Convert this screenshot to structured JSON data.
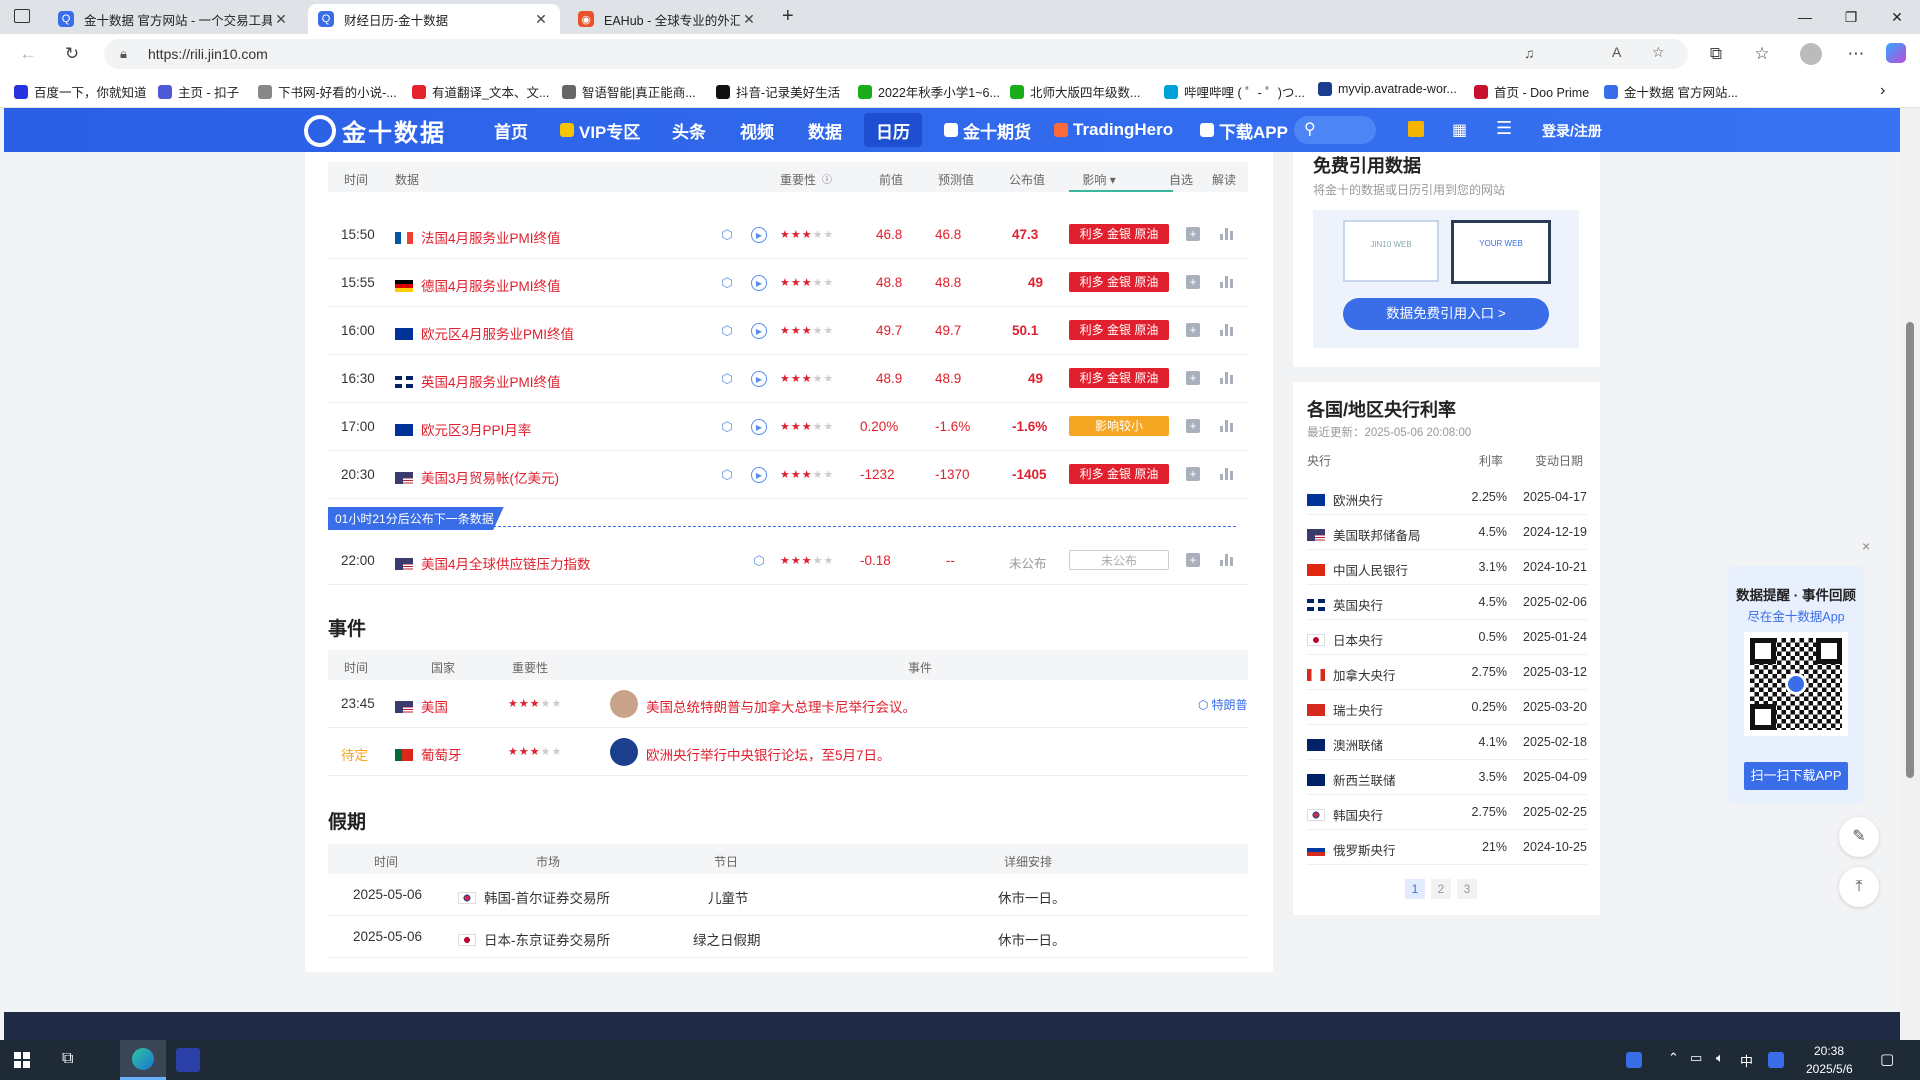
{
  "browser": {
    "tabs": [
      {
        "title": "金十数据 官方网站 - 一个交易工具",
        "active": false
      },
      {
        "title": "财经日历-金十数据",
        "active": true
      },
      {
        "title": "EAHub - 全球专业的外汇EA指标",
        "active": false
      }
    ],
    "new_tab": "+",
    "url": "https://rili.jin10.com",
    "bookmarks": [
      "百度一下，你就知道",
      "主页 - 扣子",
      "下书网-好看的小说-...",
      "有道翻译_文本、文...",
      "智语智能|真正能商...",
      "抖音-记录美好生活",
      "2022年秋季小学1~6...",
      "北师大版四年级数...",
      "哔哩哔哩 ( ゜- ゜)つ...",
      "myvip.avatrade-wor...",
      "首页 - Doo Prime",
      "金十数据 官方网站..."
    ]
  },
  "site": {
    "logo": "金十数据",
    "nav": [
      "首页",
      "VIP专区",
      "头条",
      "视频",
      "数据",
      "日历",
      "金十期货",
      "TradingHero",
      "下载APP"
    ],
    "active_nav": "日历",
    "login": "登录/注册"
  },
  "data_table": {
    "headers": {
      "time": "时间",
      "data": "数据",
      "importance": "重要性",
      "prev": "前值",
      "forecast": "预测值",
      "actual": "公布值",
      "impact": "影响",
      "watch": "自选",
      "interpret": "解读"
    },
    "rows": [
      {
        "time": "15:50",
        "country": "fr",
        "name": "法国4月服务业PMI终值",
        "stars": 3,
        "prev": "46.8",
        "forecast": "46.8",
        "actual": "47.3",
        "impact": "利多 金银 原油",
        "impact_type": "red",
        "has_video": true
      },
      {
        "time": "15:55",
        "country": "de",
        "name": "德国4月服务业PMI终值",
        "stars": 3,
        "prev": "48.8",
        "forecast": "48.8",
        "actual": "49",
        "impact": "利多 金银 原油",
        "impact_type": "red",
        "has_video": true
      },
      {
        "time": "16:00",
        "country": "eu",
        "name": "欧元区4月服务业PMI终值",
        "stars": 3,
        "prev": "49.7",
        "forecast": "49.7",
        "actual": "50.1",
        "impact": "利多 金银 原油",
        "impact_type": "red",
        "has_video": true
      },
      {
        "time": "16:30",
        "country": "uk",
        "name": "英国4月服务业PMI终值",
        "stars": 3,
        "prev": "48.9",
        "forecast": "48.9",
        "actual": "49",
        "impact": "利多 金银 原油",
        "impact_type": "red",
        "has_video": true
      },
      {
        "time": "17:00",
        "country": "eu",
        "name": "欧元区3月PPI月率",
        "stars": 3,
        "prev": "0.20%",
        "forecast": "-1.6%",
        "actual": "-1.6%",
        "impact": "影响较小",
        "impact_type": "orange",
        "has_video": true
      },
      {
        "time": "20:30",
        "country": "us",
        "name": "美国3月贸易帐(亿美元)",
        "stars": 3,
        "prev": "-1232",
        "forecast": "-1370",
        "actual": "-1405",
        "impact": "利多 金银 原油",
        "impact_type": "red",
        "has_video": true
      }
    ],
    "countdown": "01小时21分后公布下一条数据",
    "pending_row": {
      "time": "22:00",
      "country": "us",
      "name": "美国4月全球供应链压力指数",
      "stars": 3,
      "prev": "-0.18",
      "forecast": "--",
      "actual": "未公布",
      "impact": "未公布"
    }
  },
  "events": {
    "title": "事件",
    "headers": {
      "time": "时间",
      "country": "国家",
      "importance": "重要性",
      "event": "事件"
    },
    "rows": [
      {
        "time": "23:45",
        "country": "美国",
        "flag": "us",
        "stars": 3,
        "text": "美国总统特朗普与加拿大总理卡尼举行会议。",
        "tag": "特朗普"
      },
      {
        "time": "待定",
        "country": "葡萄牙",
        "flag": "pt",
        "stars": 3,
        "text": "欧洲央行举行中央银行论坛，至5月7日。",
        "tag": ""
      }
    ]
  },
  "holidays": {
    "title": "假期",
    "headers": {
      "time": "时间",
      "market": "市场",
      "festival": "节日",
      "detail": "详细安排"
    },
    "rows": [
      {
        "time": "2025-05-06",
        "flag": "kr",
        "market": "韩国-首尔证券交易所",
        "festival": "儿童节",
        "detail": "休市一日。"
      },
      {
        "time": "2025-05-06",
        "flag": "jp",
        "market": "日本-东京证券交易所",
        "festival": "绿之日假期",
        "detail": "休市一日。"
      }
    ]
  },
  "free_data": {
    "title": "免费引用数据",
    "subtitle": "将金十的数据或日历引用到您的网站",
    "img_left": "JIN10 WEB",
    "img_right": "YOUR WEB",
    "button": "数据免费引用入口 >"
  },
  "central_banks": {
    "title": "各国/地区央行利率",
    "updated": "最近更新：2025-05-06 20:08:00",
    "headers": {
      "bank": "央行",
      "rate": "利率",
      "date": "变动日期"
    },
    "rows": [
      {
        "flag": "eu",
        "bank": "欧洲央行",
        "rate": "2.25%",
        "date": "2025-04-17"
      },
      {
        "flag": "us",
        "bank": "美国联邦储备局",
        "rate": "4.5%",
        "date": "2024-12-19"
      },
      {
        "flag": "cn",
        "bank": "中国人民银行",
        "rate": "3.1%",
        "date": "2024-10-21"
      },
      {
        "flag": "uk",
        "bank": "英国央行",
        "rate": "4.5%",
        "date": "2025-02-06"
      },
      {
        "flag": "jp",
        "bank": "日本央行",
        "rate": "0.5%",
        "date": "2025-01-24"
      },
      {
        "flag": "ca",
        "bank": "加拿大央行",
        "rate": "2.75%",
        "date": "2025-03-12"
      },
      {
        "flag": "ch",
        "bank": "瑞士央行",
        "rate": "0.25%",
        "date": "2025-03-20"
      },
      {
        "flag": "au",
        "bank": "澳洲联储",
        "rate": "4.1%",
        "date": "2025-02-18"
      },
      {
        "flag": "nz",
        "bank": "新西兰联储",
        "rate": "3.5%",
        "date": "2025-04-09"
      },
      {
        "flag": "kr",
        "bank": "韩国央行",
        "rate": "2.75%",
        "date": "2025-02-25"
      },
      {
        "flag": "ru",
        "bank": "俄罗斯央行",
        "rate": "21%",
        "date": "2024-10-25"
      }
    ],
    "pages": [
      "1",
      "2",
      "3"
    ]
  },
  "promo": {
    "title": "数据提醒 · 事件回顾",
    "subtitle": "尽在金十数据App",
    "button": "扫一扫下载APP",
    "close": "×"
  },
  "taskbar": {
    "time": "20:38",
    "date": "2025/5/6",
    "ime": "中"
  }
}
